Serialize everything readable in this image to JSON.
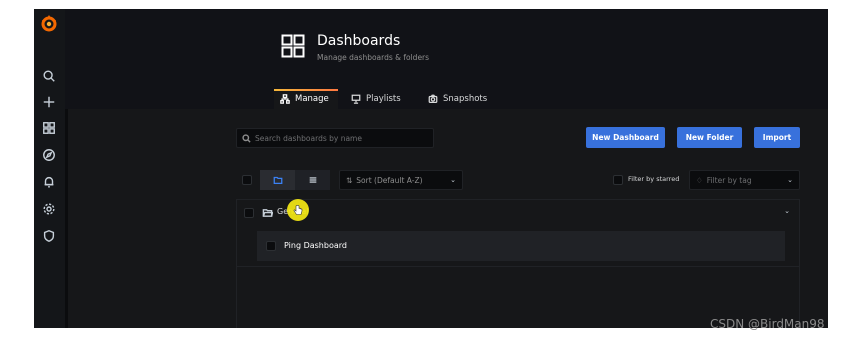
{
  "header": {
    "title": "Dashboards",
    "subtitle": "Manage dashboards & folders",
    "icon": "dashboards-grid-icon"
  },
  "tabs": [
    {
      "label": "Manage",
      "icon": "sitemap-icon",
      "active": true
    },
    {
      "label": "Playlists",
      "icon": "presentation-icon",
      "active": false
    },
    {
      "label": "Snapshots",
      "icon": "camera-icon",
      "active": false
    }
  ],
  "sidebar": {
    "items": [
      {
        "icon": "grafana-logo"
      },
      {
        "icon": "search-icon"
      },
      {
        "icon": "plus-icon"
      },
      {
        "icon": "dashboards-icon"
      },
      {
        "icon": "compass-icon"
      },
      {
        "icon": "bell-icon"
      },
      {
        "icon": "gear-icon"
      },
      {
        "icon": "shield-icon"
      }
    ]
  },
  "search": {
    "placeholder": "Search dashboards by name",
    "value": ""
  },
  "actions": {
    "new_dashboard": "New Dashboard",
    "new_folder": "New Folder",
    "import": "Import"
  },
  "filters": {
    "sort": "Sort (Default A-Z)",
    "starred_label": "Filter by starred",
    "tag_placeholder": "Filter by tag"
  },
  "results": {
    "folder_name": "General",
    "dashboards": [
      {
        "name": "Ping Dashboard"
      }
    ]
  },
  "watermark": "CSDN @BirdMan98",
  "colors": {
    "primary_button": "#3871dc",
    "tab_accent": "#ff7941",
    "background": "#161719",
    "logo": "#f46800"
  }
}
